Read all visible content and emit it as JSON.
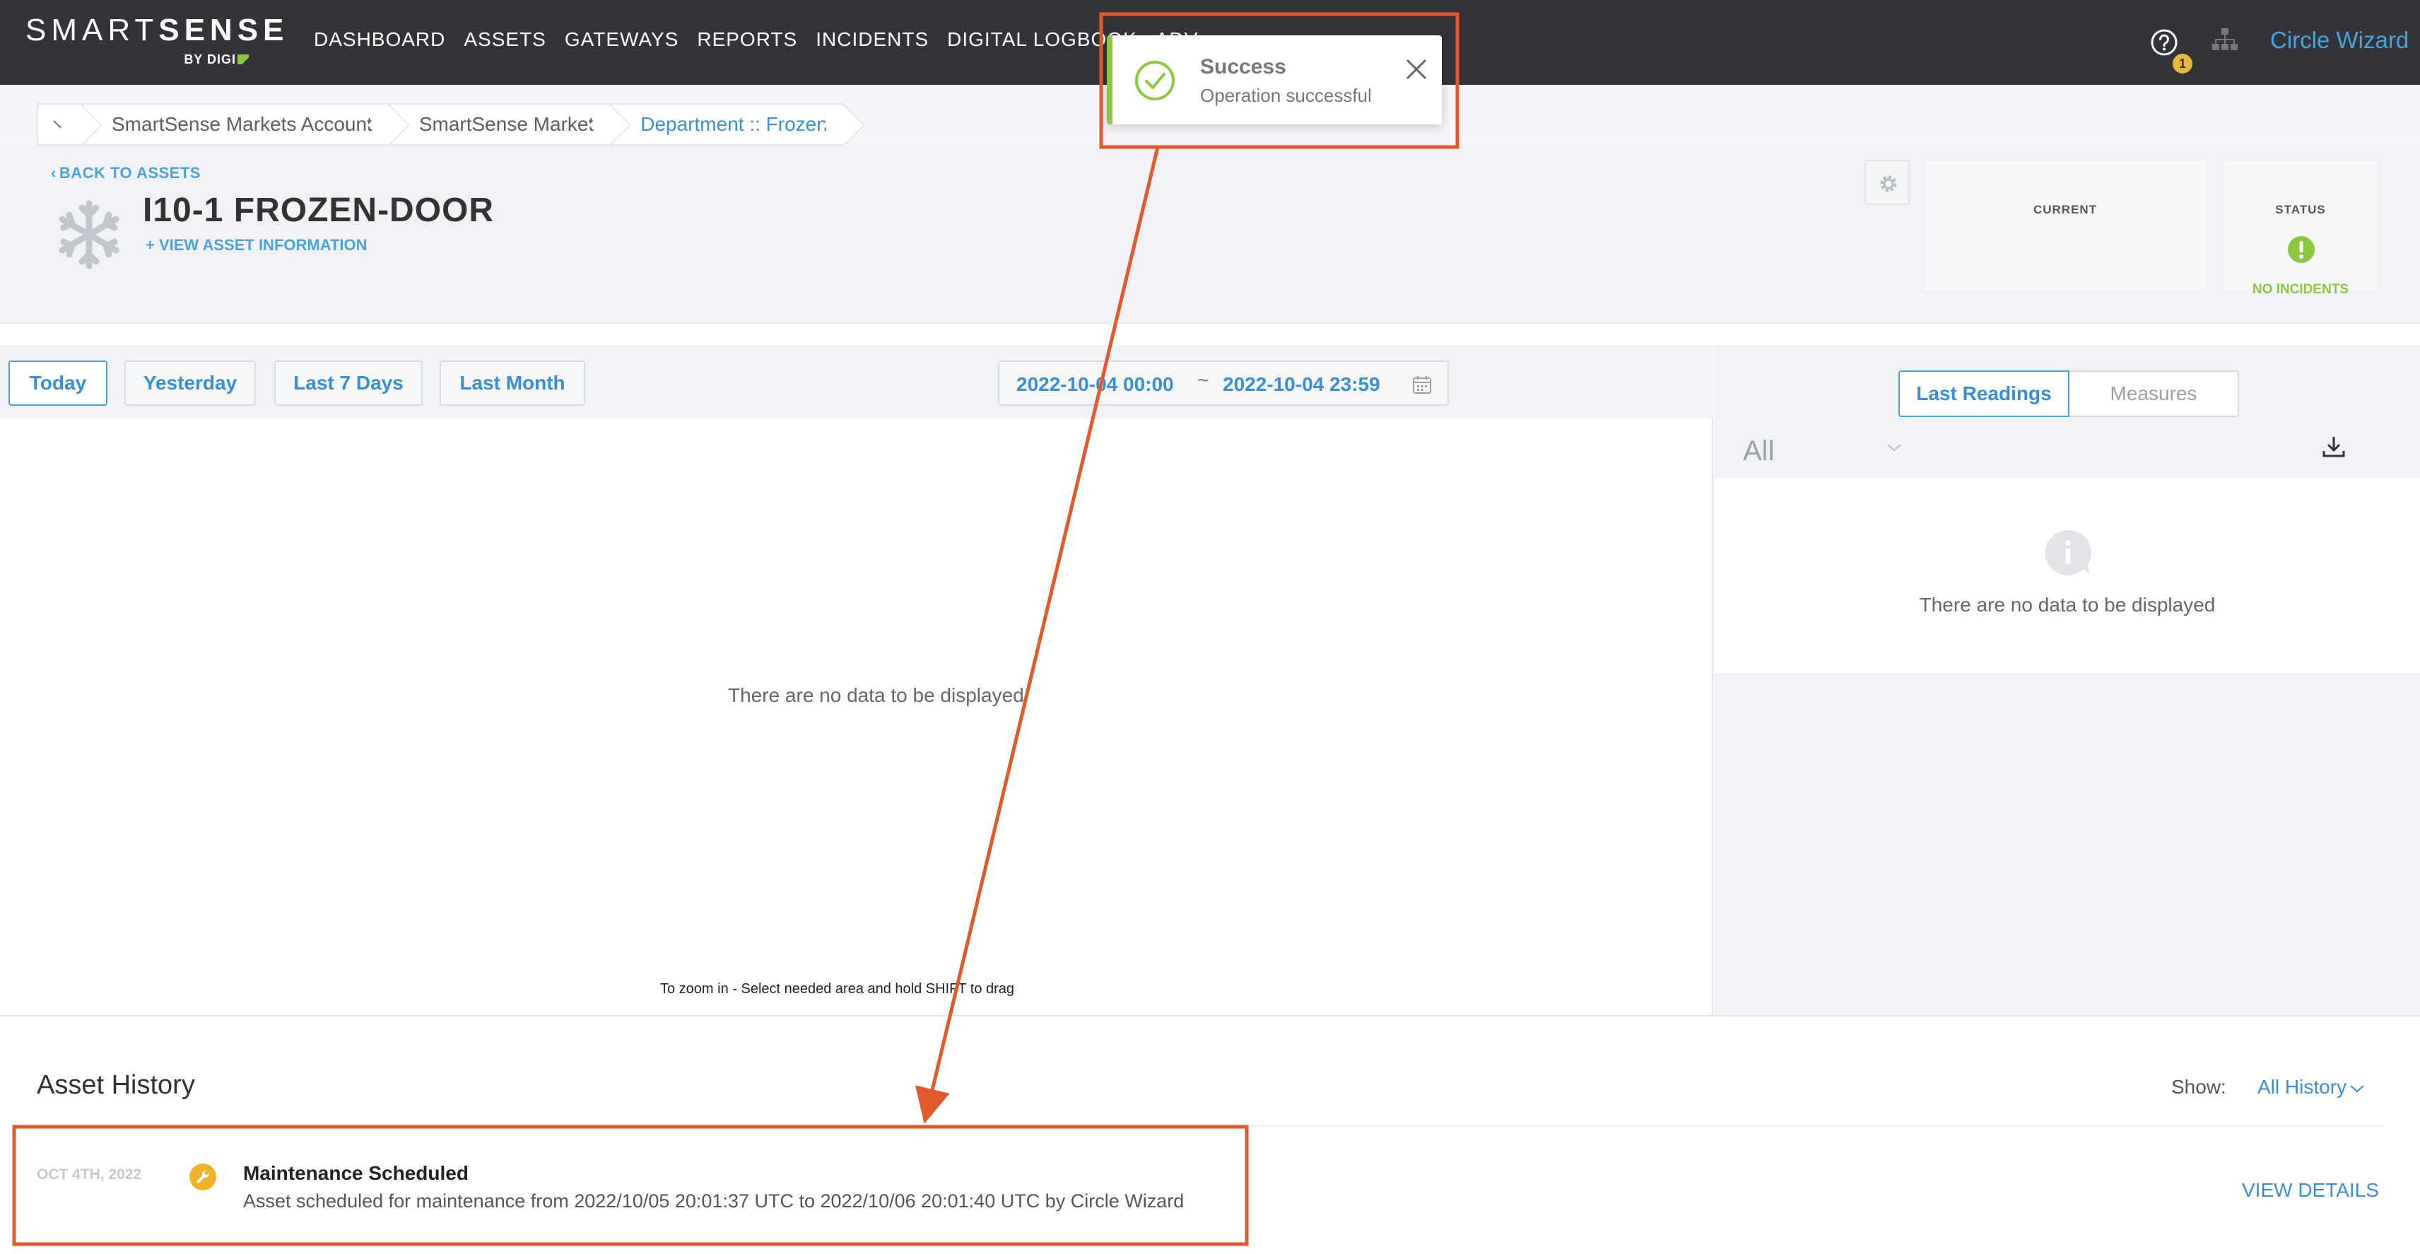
{
  "brand": {
    "name_light": "SMART",
    "name_bold": "SENSE",
    "byline": "BY DIGI"
  },
  "nav": {
    "items": [
      "DASHBOARD",
      "ASSETS",
      "GATEWAYS",
      "REPORTS",
      "INCIDENTS",
      "DIGITAL LOGBOOK",
      "ADV"
    ]
  },
  "header": {
    "help_badge": "1",
    "user_name": "Circle Wizard"
  },
  "breadcrumb": {
    "items": [
      "SmartSense Markets Account",
      "SmartSense Market",
      "Department :: Frozen"
    ]
  },
  "asset": {
    "back_label": "BACK TO ASSETS",
    "title": "I10-1 FROZEN-DOOR",
    "view_info": "+ VIEW ASSET INFORMATION",
    "current_label": "CURRENT",
    "status_label": "STATUS",
    "status_text": "NO INCIDENTS"
  },
  "toolbar": {
    "ranges": [
      "Today",
      "Yesterday",
      "Last 7 Days",
      "Last Month"
    ],
    "active_range": "Today",
    "date_from": "2022-10-04 00:00",
    "date_sep": "~",
    "date_to": "2022-10-04 23:59"
  },
  "chart": {
    "empty_text": "There are no data to be displayed",
    "zoom_hint": "To zoom in - Select needed area and hold SHIFT to drag"
  },
  "readings": {
    "tab_active": "Last Readings",
    "tab_inactive": "Measures",
    "filter": "All",
    "empty_text": "There are no data to be displayed"
  },
  "history": {
    "title": "Asset History",
    "show_label": "Show:",
    "show_value": "All History",
    "entries": [
      {
        "date": "OCT 4TH, 2022",
        "title": "Maintenance Scheduled",
        "description": "Asset scheduled for maintenance from 2022/10/05 20:01:37 UTC to 2022/10/06 20:01:40 UTC by Circle Wizard",
        "action": "VIEW DETAILS"
      }
    ]
  },
  "toast": {
    "title": "Success",
    "message": "Operation successful"
  },
  "colors": {
    "accent": "#4aa3df",
    "success": "#8dc63f",
    "annotation": "#e05a2b",
    "topbar": "#333438"
  }
}
